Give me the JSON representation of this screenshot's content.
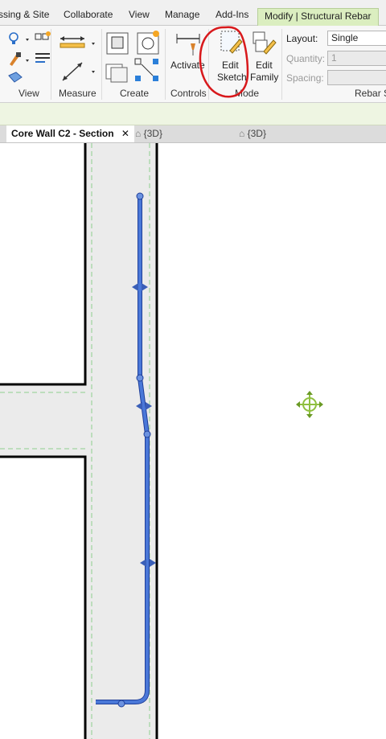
{
  "ribbon_tabs": [
    {
      "label": "ssing & Site",
      "active": false
    },
    {
      "label": "Collaborate",
      "active": false
    },
    {
      "label": "View",
      "active": false
    },
    {
      "label": "Manage",
      "active": false
    },
    {
      "label": "Add-Ins",
      "active": false
    },
    {
      "label": "Modify | Structural Rebar",
      "active": true
    }
  ],
  "panels": {
    "view": "View",
    "measure": "Measure",
    "create": "Create",
    "controls": "Controls",
    "mode": "Mode",
    "rebar_set": "Rebar S"
  },
  "tools": {
    "activate": "Activate",
    "edit_sketch_line1": "Edit",
    "edit_sketch_line2": "Sketch",
    "edit_family_line1": "Edit",
    "edit_family_line2": "Family"
  },
  "rebar_set": {
    "layout_label": "Layout:",
    "layout_value": "Single",
    "quantity_label": "Quantity:",
    "quantity_value": "1",
    "spacing_label": "Spacing:",
    "spacing_value": ""
  },
  "view_tabs": [
    {
      "label": "Core Wall C2 - Section",
      "active": true
    },
    {
      "label": "{3D}",
      "active": false
    },
    {
      "label": "{3D}",
      "active": false
    }
  ],
  "colors": {
    "rebar": "#4a78d8",
    "rebar_stroke": "#1f3f99",
    "wall_fill": "#ebebeb",
    "wall_edge": "#000000",
    "grid_dash": "#8fcf8f",
    "active_tab": "#dbeec0",
    "annotation": "#d8191c",
    "move_icon": "#8fbf3f"
  },
  "icons": [
    "bulb-icon",
    "paint-icon",
    "eraser-icon",
    "dimension-icon",
    "align-icon",
    "measure-line-icon",
    "create-component-icon",
    "group-icon",
    "array-icon",
    "parts-icon",
    "pin-icon",
    "edit-sketch-icon",
    "edit-family-icon",
    "move-crosshair-icon"
  ]
}
